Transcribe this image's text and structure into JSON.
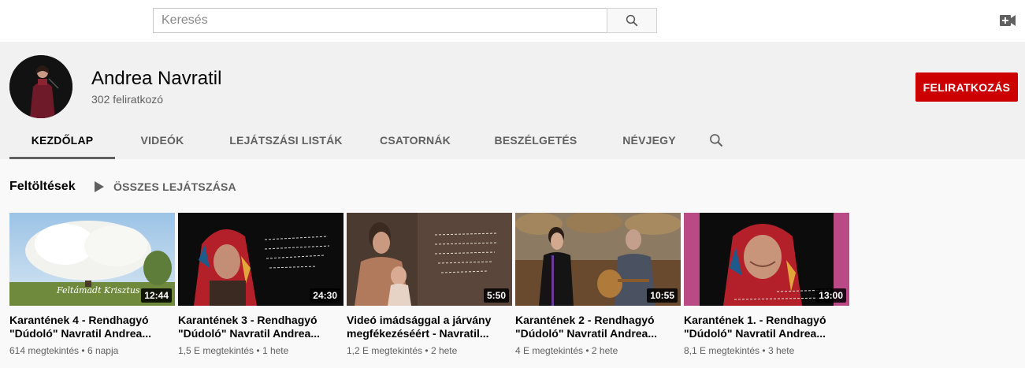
{
  "search": {
    "placeholder": "Keresés"
  },
  "channel": {
    "name": "Andrea Navratil",
    "subscribers": "302 feliratkozó",
    "subscribe_label": "FELIRATKOZÁS"
  },
  "tabs": [
    {
      "label": "KEZDŐLAP",
      "active": true
    },
    {
      "label": "VIDEÓK"
    },
    {
      "label": "LEJÁTSZÁSI LISTÁK"
    },
    {
      "label": "CSATORNÁK"
    },
    {
      "label": "BESZÉLGETÉS"
    },
    {
      "label": "NÉVJEGY"
    }
  ],
  "section": {
    "title": "Feltöltések",
    "play_all": "ÖSSZES LEJÁTSZÁSA"
  },
  "videos": [
    {
      "title": "Karantének 4 - Rendhagyó \"Dúdoló\" Navratil Andrea...",
      "views": "614 megtekintés",
      "age": "6 napja",
      "duration": "12:44",
      "thumb_text": "Feltámadt Krisztus"
    },
    {
      "title": "Karantének 3 - Rendhagyó \"Dúdoló\" Navratil Andrea...",
      "views": "1,5 E megtekintés",
      "age": "1 hete",
      "duration": "24:30"
    },
    {
      "title": "Videó imádsággal a járvány megfékezéséért - Navratil...",
      "views": "1,2 E megtekintés",
      "age": "2 hete",
      "duration": "5:50"
    },
    {
      "title": "Karantének 2 - Rendhagyó \"Dúdoló\" Navratil Andrea...",
      "views": "4 E megtekintés",
      "age": "2 hete",
      "duration": "10:55"
    },
    {
      "title": "Karantének 1. - Rendhagyó \"Dúdoló\" Navratil Andrea...",
      "views": "8,1 E megtekintés",
      "age": "3 hete",
      "duration": "13:00"
    }
  ],
  "colors": {
    "accent": "#cc0000",
    "header_bg": "#f1f1f1",
    "page_bg": "#f9f9f9"
  }
}
